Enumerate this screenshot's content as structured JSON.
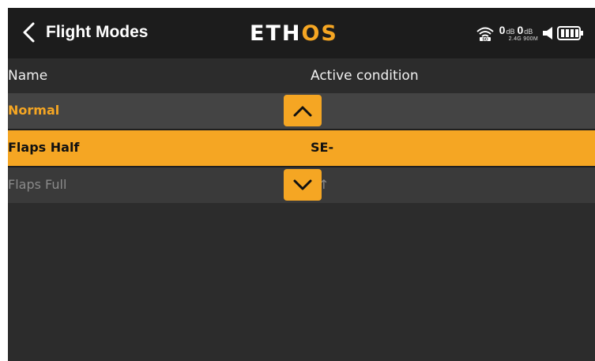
{
  "header": {
    "title": "Flight Modes",
    "logo_main": "ETH",
    "logo_accent": "OS",
    "rssi_1": "0",
    "rssi_1_unit": "dB",
    "rssi_2": "0",
    "rssi_2_unit": "dB",
    "frequencies": "2.4G 900M",
    "icons": [
      "back-chevron-icon",
      "wifi-icon",
      "speaker-icon",
      "battery-icon"
    ]
  },
  "table": {
    "columns": [
      "Name",
      "Active condition"
    ],
    "rows": [
      {
        "name": "Normal",
        "condition": "-",
        "state": "active"
      },
      {
        "name": "Flaps Half",
        "condition": "SE-",
        "state": "selected"
      },
      {
        "name": "Flaps Full",
        "condition": "E↑",
        "state": "disabled"
      }
    ]
  },
  "controls": {
    "move_up_icon": "chevron-up-icon",
    "move_down_icon": "chevron-down-icon"
  },
  "colors": {
    "accent": "#f5a623",
    "background": "#2c2c2c",
    "topbar": "#1c1c1c"
  }
}
